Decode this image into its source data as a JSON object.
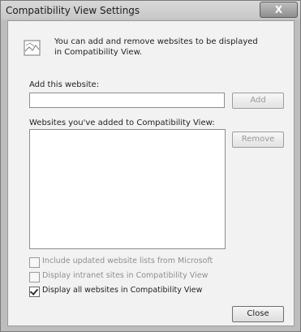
{
  "window": {
    "title": "Compatibility View Settings",
    "close_glyph": "X"
  },
  "intro": {
    "icon": "globe-page-icon",
    "text": "You can add and remove websites to be displayed in Compatibility View."
  },
  "add_site": {
    "label": "Add this website:",
    "value": "",
    "add_button": "Add"
  },
  "list": {
    "label": "Websites you've added to Compatibility View:",
    "items": [],
    "remove_button": "Remove"
  },
  "options": [
    {
      "label": "Include updated website lists from Microsoft",
      "checked": false,
      "enabled": false
    },
    {
      "label": "Display intranet sites in Compatibility View",
      "checked": false,
      "enabled": false
    },
    {
      "label": "Display all websites in Compatibility View",
      "checked": true,
      "enabled": true
    }
  ],
  "footer": {
    "close_button": "Close"
  }
}
